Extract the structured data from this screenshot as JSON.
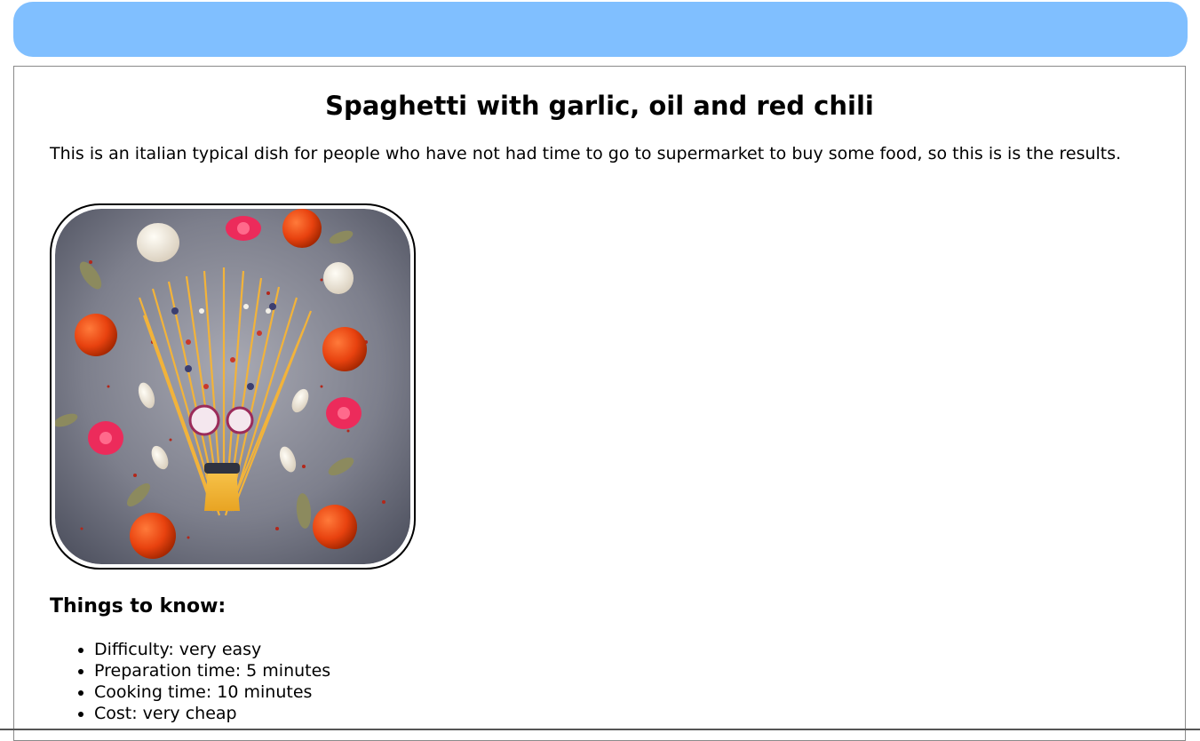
{
  "colors": {
    "header_bar": "#80bfff",
    "border": "#8a8a8a"
  },
  "recipe": {
    "title": "Spaghetti with garlic, oil and red chili",
    "intro": "This is an italian typical dish for people who have not had time to go to supermarket to buy some food, so this is is the results.",
    "things_heading": "Things to know:",
    "facts": [
      "Difficulty: very easy",
      "Preparation time: 5 minutes",
      "Cooking time: 10 minutes",
      "Cost: very cheap"
    ]
  }
}
